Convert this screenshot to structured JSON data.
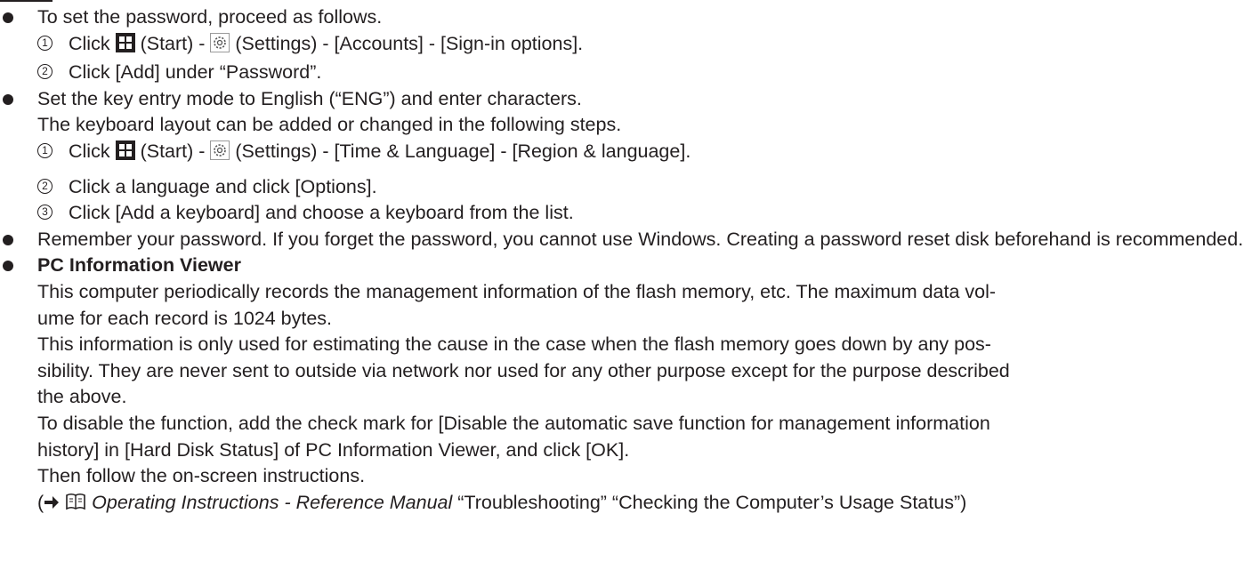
{
  "icons": {
    "start": "windows-start-icon",
    "settings": "settings-gear-icon",
    "manual": "reference-manual-book-icon",
    "arrow": "right-arrow-icon"
  },
  "bullets": {
    "password": {
      "intro": "To set the password, proceed as follows.",
      "step1": {
        "number": "1",
        "before": "Click",
        "start_label": "(Start) -",
        "after": "(Settings) - [Accounts] - [Sign-in options]."
      },
      "step2": {
        "number": "2",
        "text": "Click [Add] under “Password”."
      }
    },
    "keyboard": {
      "line1": "Set the key entry mode to English (“ENG”) and enter characters.",
      "line2": "The keyboard layout can be added or changed in the following steps.",
      "step1": {
        "number": "1",
        "before": "Click",
        "start_label": "(Start) -",
        "after": "(Settings) - [Time & Language] - [Region & language]."
      },
      "step2": {
        "number": "2",
        "text": "Click a language and click [Options]."
      },
      "step3": {
        "number": "3",
        "text": "Click [Add a keyboard] and choose a keyboard from the list."
      }
    },
    "remember": {
      "text": "Remember your password. If you forget the password, you cannot use Windows. Creating a password reset disk beforehand is recommended."
    },
    "pc_info": {
      "heading": "PC Information Viewer",
      "p1a": "This computer periodically records the management information of the flash memory, etc. The maximum data vol-",
      "p1b": "ume for each record is 1024 bytes.",
      "p2a": "This information is only used for estimating the cause in the case when the flash memory goes down by any pos-",
      "p2b": "sibility. They are never sent to outside via network nor used for any other purpose except for the purpose described",
      "p2c": "the above.",
      "p3a": "To disable the function, add the check mark for [Disable the automatic save function for management information",
      "p3b": "history] in [Hard Disk Status] of PC Information Viewer, and click [OK].",
      "p4": "Then follow the on-screen instructions.",
      "ref": {
        "open": "(",
        "title": "Operating Instructions - Reference Manual",
        "rest": "“Troubleshooting” “Checking the Computer’s Usage Status”)"
      }
    }
  }
}
